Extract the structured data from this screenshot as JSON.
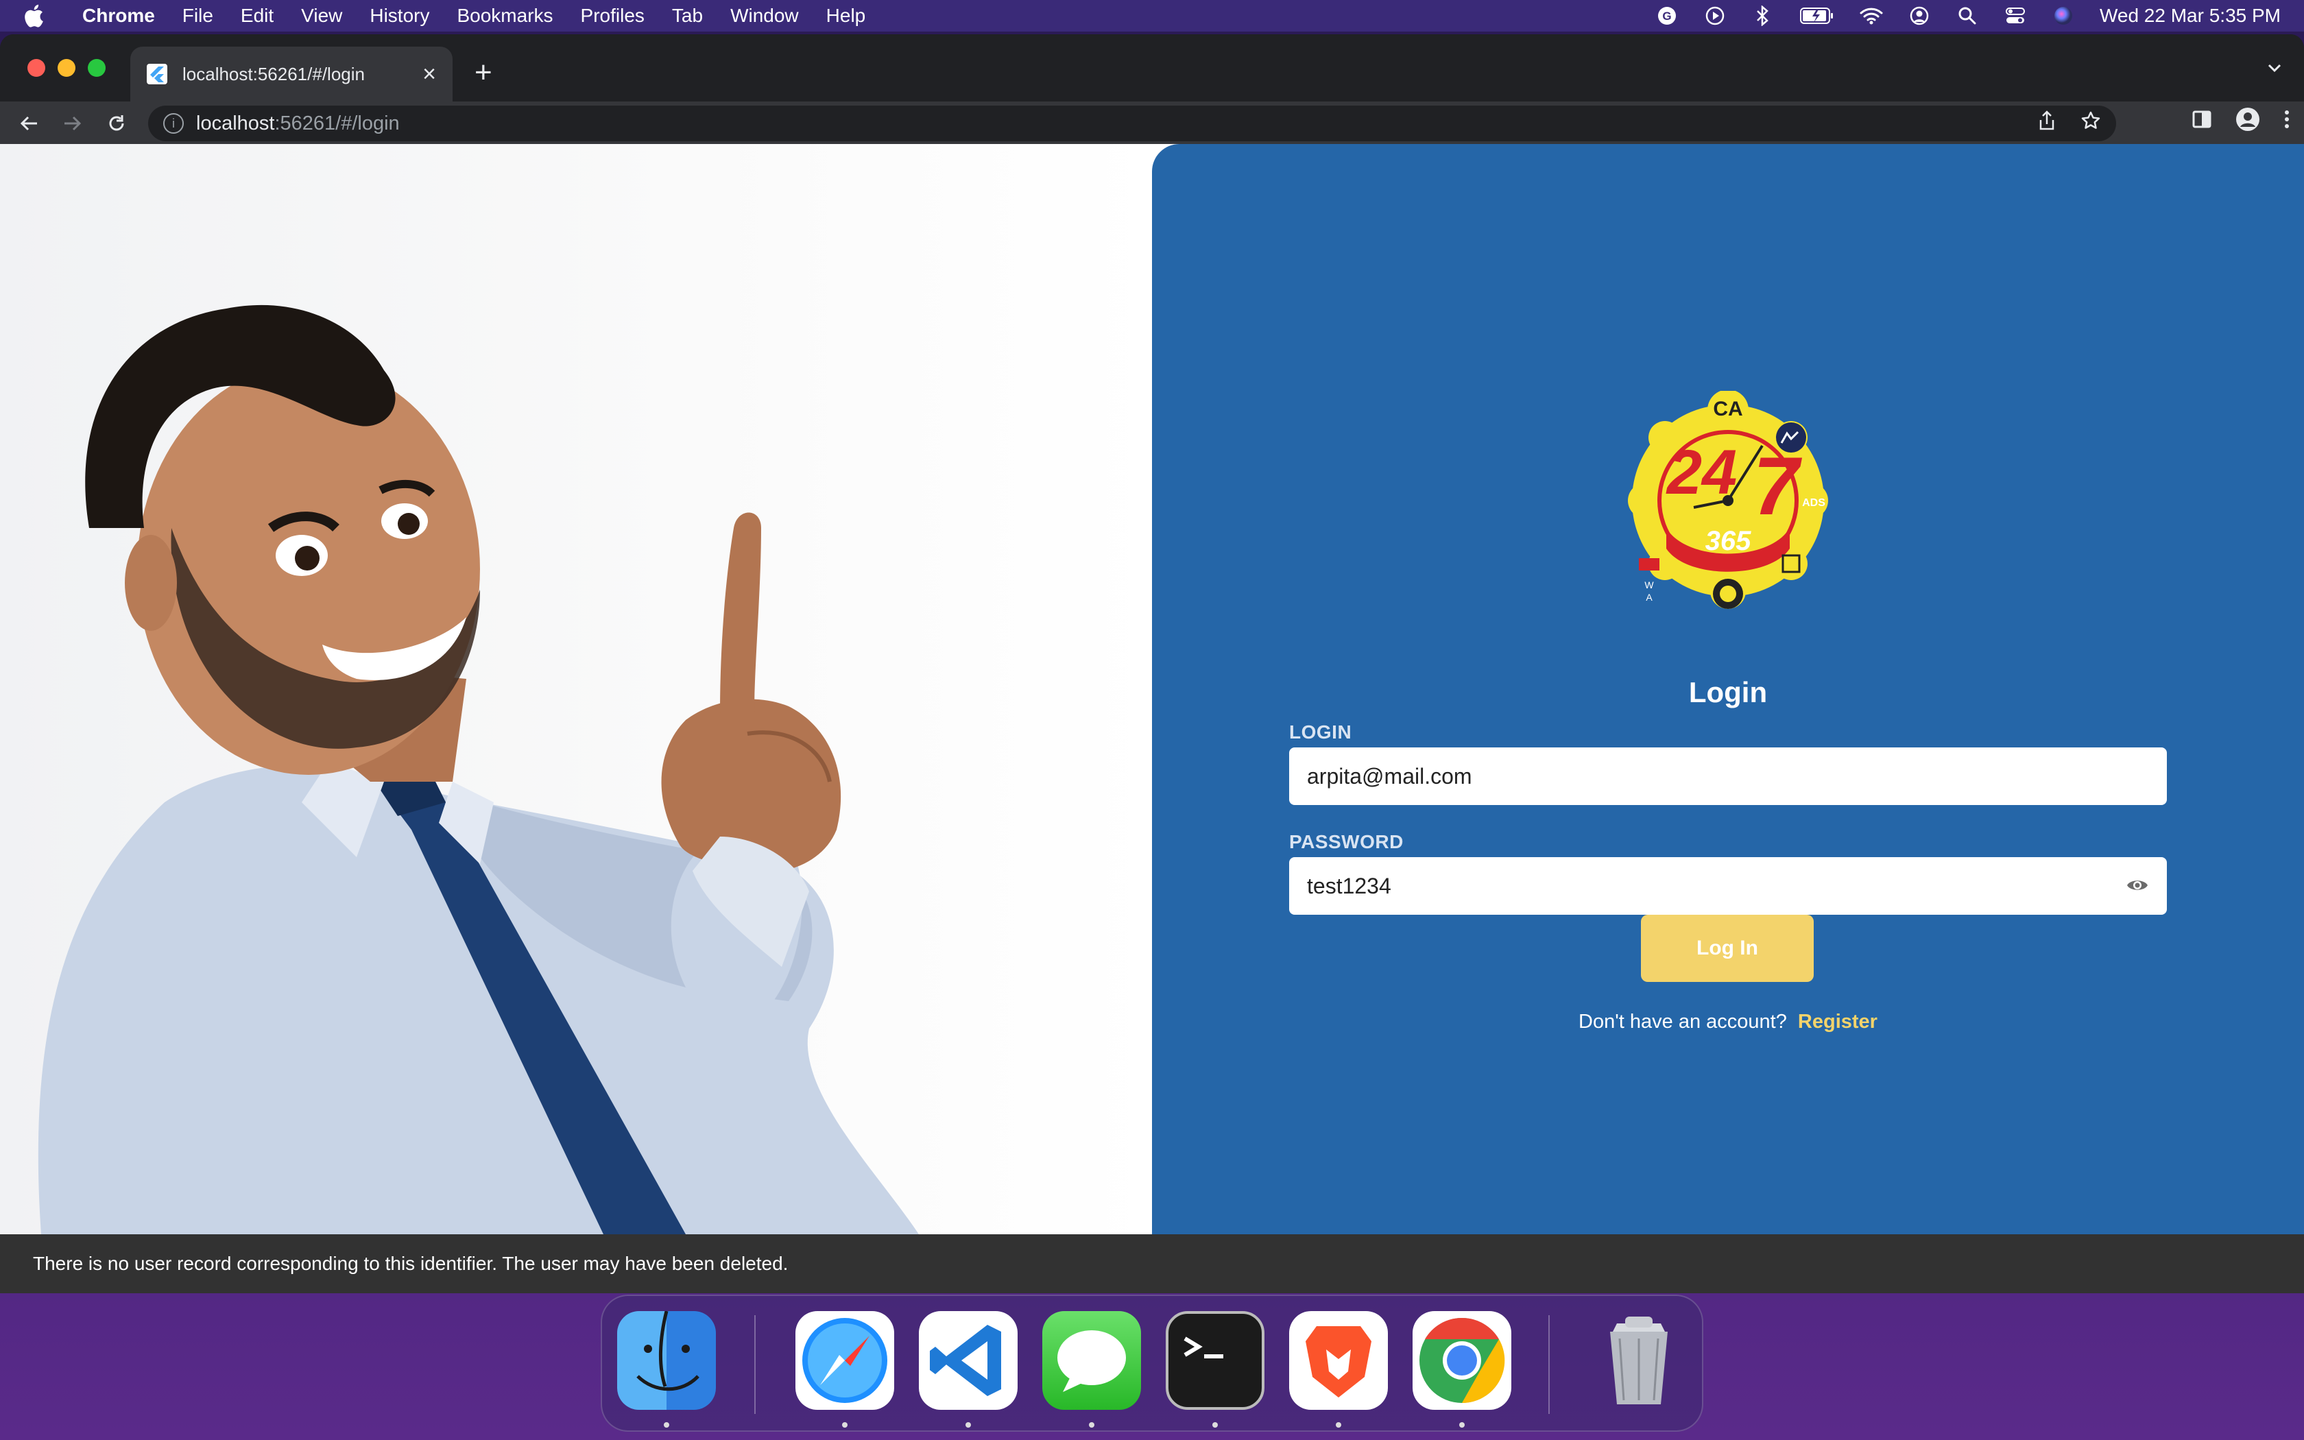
{
  "menubar": {
    "app_name": "Chrome",
    "items": [
      "File",
      "Edit",
      "View",
      "History",
      "Bookmarks",
      "Profiles",
      "Tab",
      "Window",
      "Help"
    ],
    "clock": "Wed 22 Mar  5:35 PM"
  },
  "browser": {
    "tab_title": "localhost:56261/#/login",
    "url_host": "localhost",
    "url_path": ":56261/#/login"
  },
  "logo": {
    "big_number_left": "24",
    "big_number_right": "7",
    "ribbon_text": "365",
    "top_badge": "CA",
    "right_badge": "ADS",
    "left_badge": "W\nA"
  },
  "login": {
    "title": "Login",
    "login_label": "LOGIN",
    "login_value": "arpita@mail.com",
    "password_label": "PASSWORD",
    "password_value": "test1234",
    "button_label": "Log In",
    "no_account_text": "Don't have an account?",
    "register_label": "Register"
  },
  "snackbar": {
    "message": "There is no user record corresponding to this identifier. The user may have been deleted."
  },
  "dock": {
    "apps": [
      "Finder",
      "Safari",
      "Visual Studio Code",
      "Messages",
      "Terminal",
      "Brave",
      "Google Chrome",
      "Trash"
    ]
  },
  "colors": {
    "panel_blue": "#2566a8",
    "accent_yellow": "#f3d36b",
    "snackbar": "#323232"
  }
}
